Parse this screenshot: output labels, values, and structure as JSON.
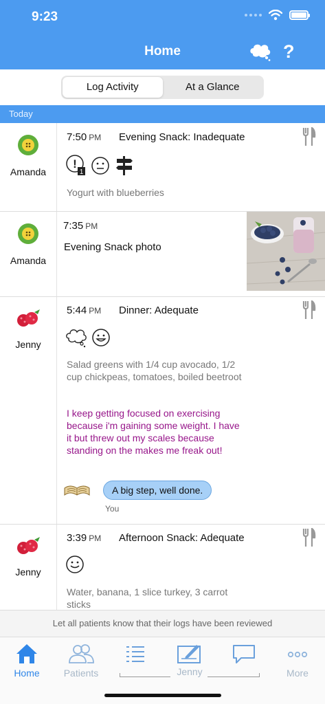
{
  "status": {
    "time": "9:23"
  },
  "header": {
    "title": "Home",
    "help": "?"
  },
  "segments": {
    "left": "Log Activity",
    "right": "At a Glance",
    "selected": "Log Activity"
  },
  "section": "Today",
  "entries": [
    {
      "patient": "Amanda",
      "time": "7:50",
      "ampm": "PM",
      "meal": "Evening Snack: Inadequate",
      "description": "Yogurt with blueberries"
    },
    {
      "patient": "Amanda",
      "time": "7:35",
      "ampm": "PM",
      "title": "Evening Snack photo"
    },
    {
      "patient": "Jenny",
      "time": "5:44",
      "ampm": "PM",
      "meal": "Dinner: Adequate",
      "description": "Salad greens with 1/4 cup avocado, 1/2 cup chickpeas, tomatoes, boiled beetroot",
      "note": "I keep getting focused on exercising because i'm gaining some weight. I have it but threw out my scales because standing on the makes me freak out!",
      "reply": "A big step, well done.",
      "reply_author": "You"
    },
    {
      "patient": "Jenny",
      "time": "3:39",
      "ampm": "PM",
      "meal": "Afternoon Snack: Adequate",
      "description": "Water, banana, 1 slice turkey, 3 carrot sticks"
    }
  ],
  "reviewed_bar": "Let all patients know that their logs have been reviewed",
  "tabs": {
    "home": "Home",
    "patients": "Patients",
    "group_label": "Jenny",
    "more": "More"
  },
  "colors": {
    "accent": "#4c9bf0",
    "note": "#97168a",
    "tab_active": "#2f86e8"
  }
}
